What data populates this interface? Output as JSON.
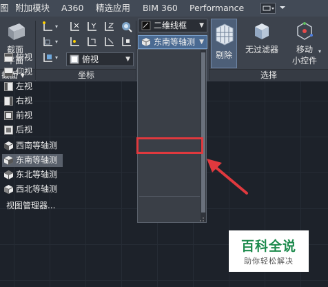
{
  "menu_tabs": [
    "图",
    "附加模块",
    "A360",
    "精选应用",
    "BIM 360",
    "Performance"
  ],
  "ribbon": {
    "section_plane": {
      "line1": "截面",
      "line2": "平面"
    },
    "section_footer": "截面 ▾",
    "ucs_footer": "坐标",
    "select_footer": "选择",
    "top_view_combo": "俯视",
    "visual_style_combo": "二维线框",
    "view_combo": "东南等轴测",
    "cull_label": "剔除",
    "no_filter_label": "无过滤器",
    "move_gizmo": {
      "line1": "移动",
      "line2": "小控件"
    }
  },
  "dropdown_items": [
    {
      "label": "俯视",
      "icon": "top-view-icon"
    },
    {
      "label": "仰视",
      "icon": "bottom-view-icon"
    },
    {
      "label": "左视",
      "icon": "left-view-icon"
    },
    {
      "label": "右视",
      "icon": "right-view-icon"
    },
    {
      "label": "前视",
      "icon": "front-view-icon"
    },
    {
      "label": "后视",
      "icon": "back-view-icon"
    },
    {
      "label": "西南等轴测",
      "icon": "sw-isometric-icon"
    },
    {
      "label": "东南等轴测",
      "icon": "se-isometric-icon"
    },
    {
      "label": "东北等轴测",
      "icon": "ne-isometric-icon"
    },
    {
      "label": "西北等轴测",
      "icon": "nw-isometric-icon"
    }
  ],
  "view_manager": "视图管理器...",
  "watermark": {
    "title": "百科全说",
    "subtitle": "助你轻松解决"
  },
  "colors": {
    "annotation": "#e0393e",
    "watermark_green": "#1c8a4c"
  }
}
